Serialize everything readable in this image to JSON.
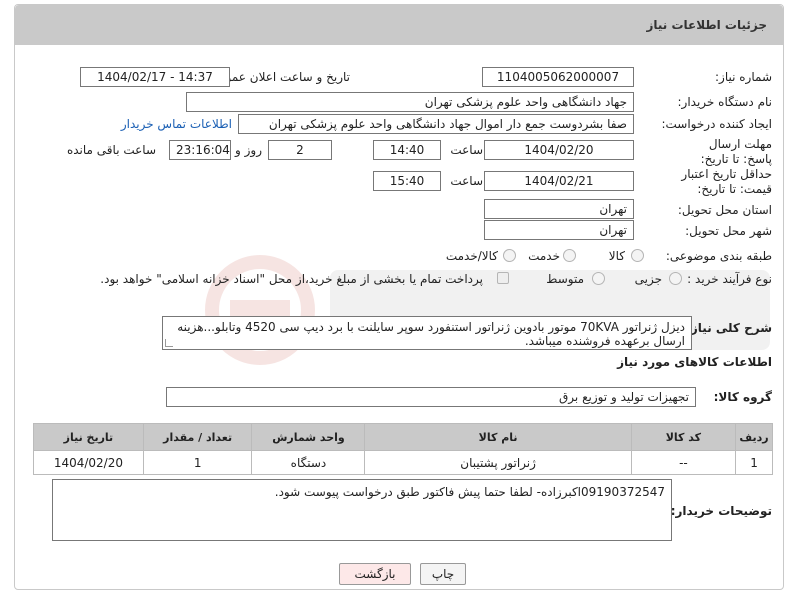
{
  "header": {
    "title": "جزئیات اطلاعات نیاز"
  },
  "fields": {
    "need_number_label": "شماره نیاز:",
    "need_number": "1104005062000007",
    "announce_label": "تاریخ و ساعت اعلان عمومی:",
    "announce_value": "1404/02/17 - 14:37",
    "buyer_org_label": "نام دستگاه خریدار:",
    "buyer_org": "جهاد دانشگاهی واحد علوم پزشکی تهران",
    "creator_label": "ایجاد کننده درخواست:",
    "creator": "صفا بشردوست جمع دار اموال  جهاد دانشگاهی واحد علوم پزشکی تهران",
    "buyer_contact_link": "اطلاعات تماس خریدار",
    "reply_deadline_label": "مهلت ارسال پاسخ: تا تاریخ:",
    "reply_date": "1404/02/20",
    "time_label": "ساعت",
    "reply_time": "14:40",
    "days_value": "2",
    "days_label": "روز و",
    "remaining_time": "23:16:04",
    "remaining_label": "ساعت باقی مانده",
    "price_validity_label": "حداقل تاریخ اعتبار قیمت: تا تاریخ:",
    "price_date": "1404/02/21",
    "price_time": "15:40",
    "province_label": "استان محل تحویل:",
    "province": "تهران",
    "city_label": "شهر محل تحویل:",
    "city": "تهران",
    "category_label": "طبقه بندی موضوعی:",
    "category_options": [
      "کالا",
      "خدمت",
      "کالا/خدمت"
    ],
    "process_label": "نوع فرآیند خرید :",
    "process_options": [
      "جزیی",
      "متوسط"
    ],
    "process_note": "پرداخت تمام یا بخشی از مبلغ خرید،از محل \"اسناد خزانه اسلامی\" خواهد بود.",
    "description_label": "شرح کلی نیاز:",
    "description": "دیزل ژنراتور 70KVA موتور بادوین ژنراتور استنفورد سوپر سایلنت با برد دیپ سی 4520 وتابلو...هزینه ارسال برعهده فروشنده میباشد."
  },
  "goods": {
    "section_title": "اطلاعات کالاهای مورد نیاز",
    "group_label": "گروه کالا:",
    "group_value": "تجهیزات تولید و توزیع برق",
    "columns": [
      "ردیف",
      "کد کالا",
      "نام کالا",
      "واحد شمارش",
      "تعداد / مقدار",
      "تاریخ نیاز"
    ],
    "rows": [
      [
        "1",
        "--",
        "ژنراتور پشتیبان",
        "دستگاه",
        "1",
        "1404/02/20"
      ]
    ]
  },
  "buyer_notes": {
    "label": "توضیحات خریدار:",
    "text": "09190372547اکبرزاده- لطفا حتما پیش فاکتور طبق درخواست پیوست  شود."
  },
  "buttons": {
    "print": "چاپ",
    "back": "بازگشت"
  },
  "colors": {
    "header_bg": "#c9c9c9",
    "link": "#1a5fb4",
    "back_button_bg": "#fde8e8"
  }
}
